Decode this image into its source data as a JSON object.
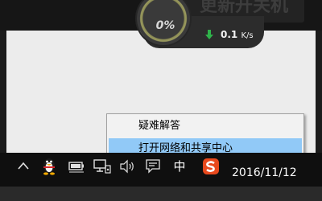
{
  "background_button": {
    "label": "更新开关机"
  },
  "speed_widget": {
    "gauge_text": "0%",
    "download_speed": "0.1",
    "download_unit": "K/s"
  },
  "context_menu": {
    "items": [
      {
        "label": "疑难解答"
      },
      {
        "label": "打开网络和共享中心",
        "highlighted": true
      }
    ]
  },
  "taskbar": {
    "tray_icons": [
      "chevron-up-icon",
      "qq-penguin-icon",
      "battery-icon",
      "network-icon",
      "volume-icon",
      "action-center-icon",
      "input-method-icon",
      "sogou-icon"
    ],
    "input_method": "中",
    "clock_date": "2016/11/12"
  },
  "colors": {
    "menu_highlight": "#91c9f7",
    "taskbar": "#0f0f0f",
    "window_area": "#ececec"
  }
}
